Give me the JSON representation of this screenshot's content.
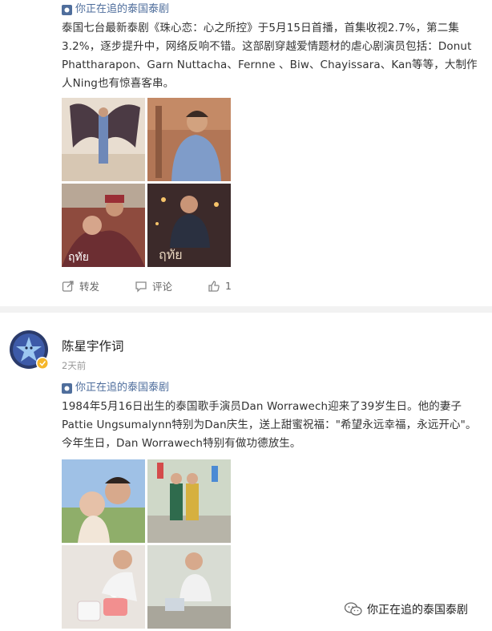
{
  "post1": {
    "topic": "你正在追的泰国泰剧",
    "body": "泰国七台最新泰剧《珠心恋：心之所控》于5月15日首播，首集收视2.7%，第二集3.2%，逐步提升中，网络反响不错。这部剧穿越爱情题材的虐心剧演员包括：Donut Phattharapon、Garn Nuttacha、Fernne 、Biw、Chayissara、Kan等等，大制作人Ning也有惊喜客串。",
    "actions": {
      "repost": "转发",
      "comment": "评论",
      "like_count": "1"
    }
  },
  "post2": {
    "username": "陈星宇作词",
    "time": "2天前",
    "topic": "你正在追的泰国泰剧",
    "body": "1984年5月16日出生的泰国歌手演员Dan Worrawech迎来了39岁生日。他的妻子Pattie Ungsumalynn特别为Dan庆生，送上甜蜜祝福：\"希望永远幸福，永远开心\"。今年生日，Dan Worrawech特别有做功德放生。"
  },
  "watermark": {
    "text": "你正在追的泰国泰剧"
  },
  "colors": {
    "link": "#4f6e9c",
    "text": "#333333",
    "muted": "#999999",
    "separator": "#f2f2f2"
  }
}
